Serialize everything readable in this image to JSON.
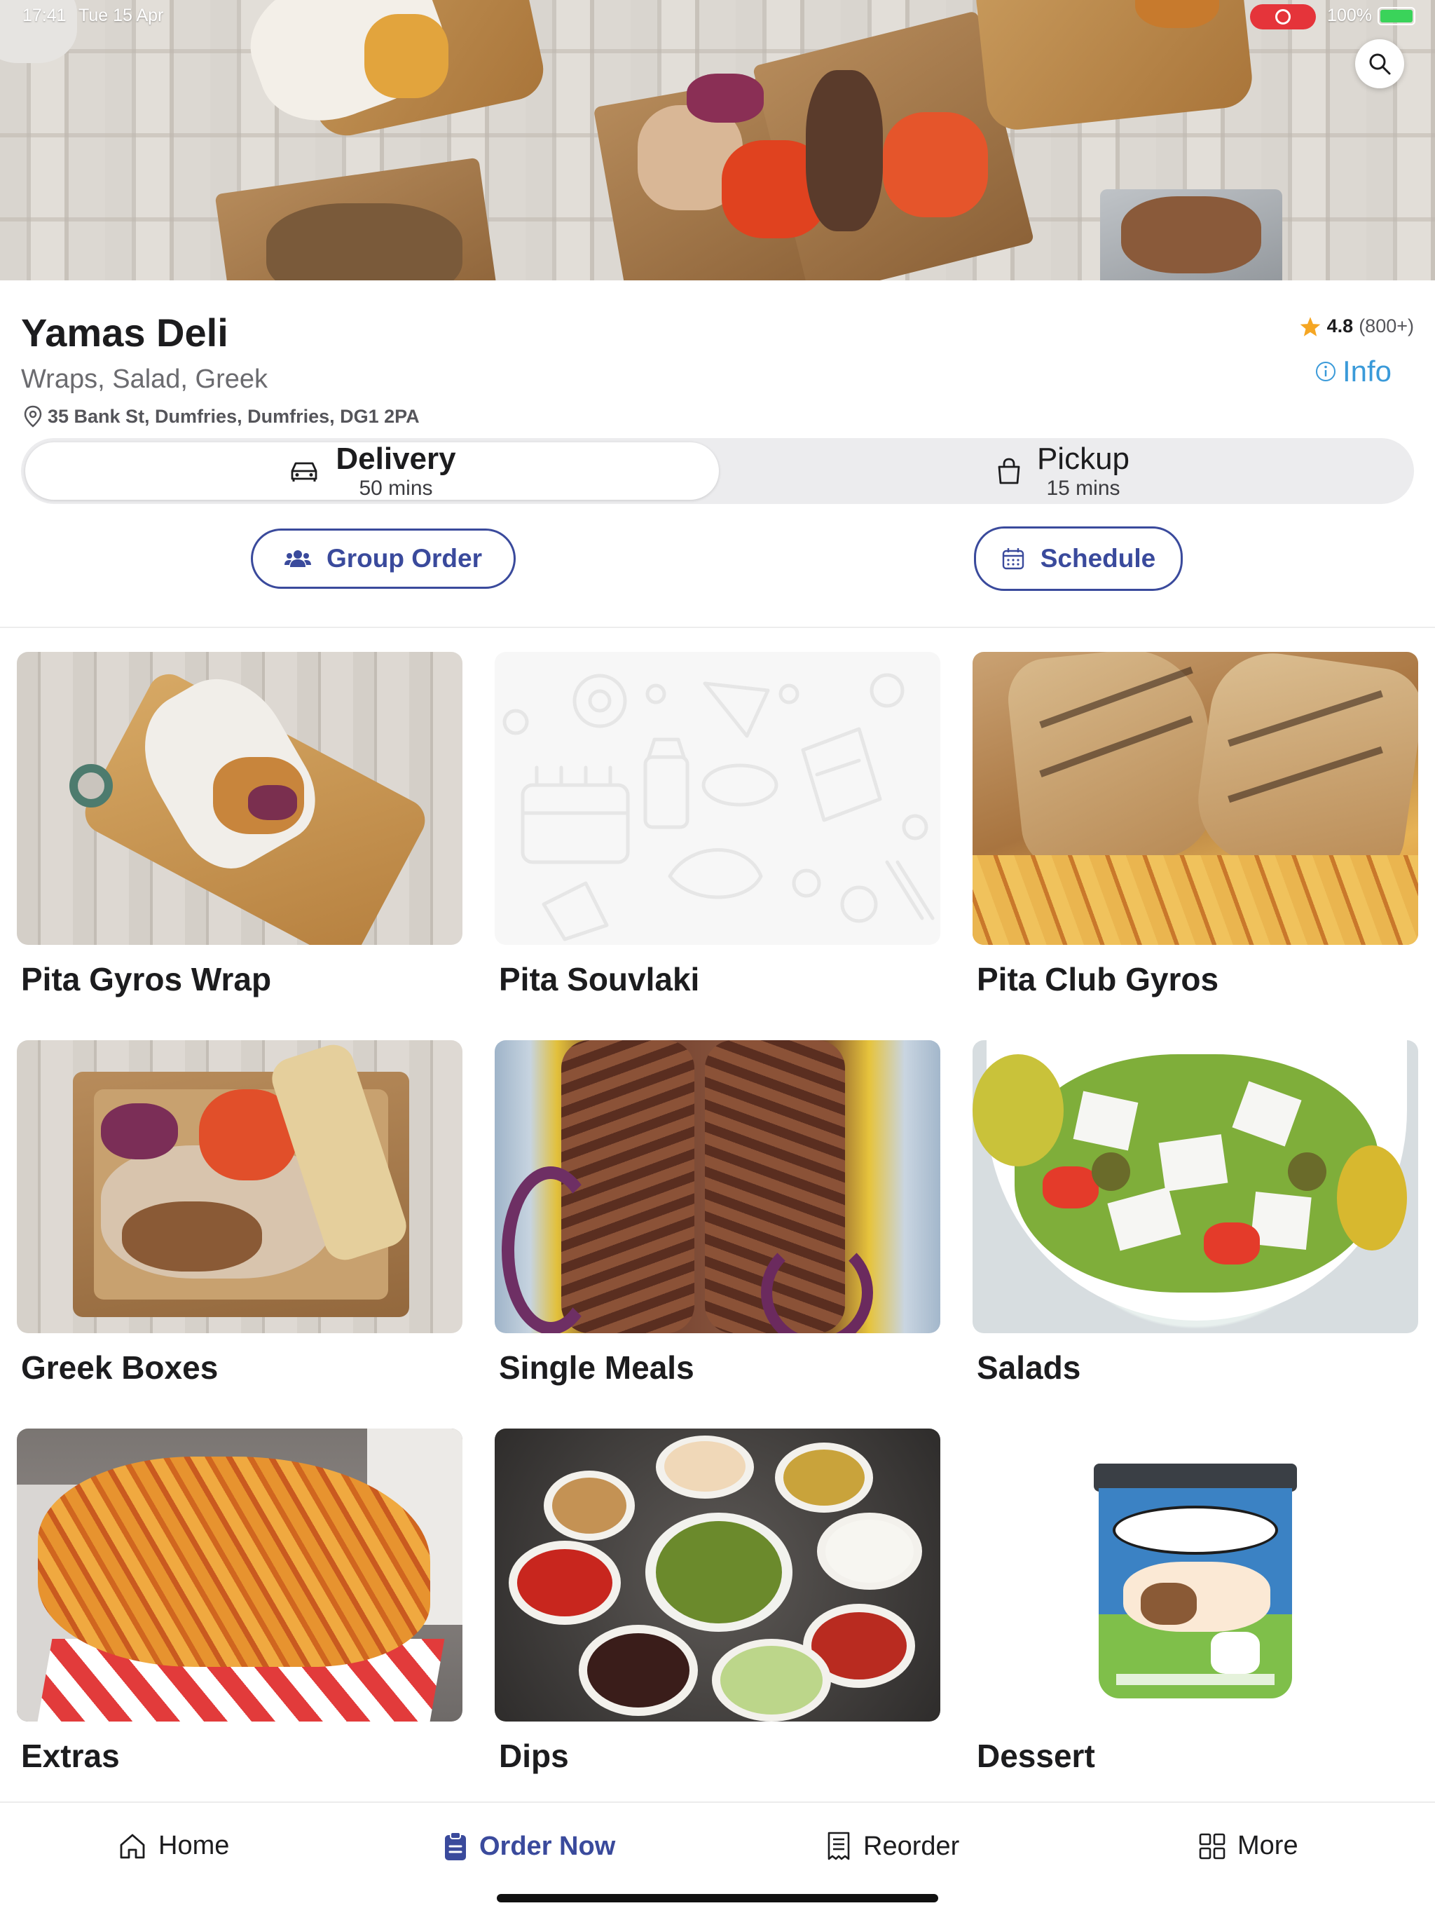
{
  "status_bar": {
    "time": "17:41",
    "date": "Tue 15 Apr",
    "battery": "100%"
  },
  "store": {
    "name": "Yamas Deli",
    "cuisine": "Wraps, Salad, Greek",
    "address": "35 Bank St, Dumfries, Dumfries, DG1 2PA",
    "rating": "4.8",
    "rating_count": "(800+)",
    "info_label": "Info"
  },
  "fulfillment": {
    "selected": "Delivery",
    "delivery": {
      "label": "Delivery",
      "time": "50 mins"
    },
    "pickup": {
      "label": "Pickup",
      "time": "15 mins"
    }
  },
  "actions": {
    "group_order": "Group Order",
    "schedule": "Schedule"
  },
  "categories": [
    {
      "label": "Pita Gyros Wrap",
      "image": "wrap-on-board"
    },
    {
      "label": "Pita Souvlaki",
      "image": "placeholder-food-doodles"
    },
    {
      "label": "Pita Club Gyros",
      "image": "grilled-pita-with-fries"
    },
    {
      "label": "Greek Boxes",
      "image": "gyros-box"
    },
    {
      "label": "Single Meals",
      "image": "grilled-kebab-tray"
    },
    {
      "label": "Salads",
      "image": "greek-salad-bowl"
    },
    {
      "label": "Extras",
      "image": "seasoned-fries"
    },
    {
      "label": "Dips",
      "image": "assorted-dips"
    },
    {
      "label": "Dessert",
      "image": "ice-cream-tub"
    }
  ],
  "bottom_nav": {
    "active": "Order Now",
    "items": [
      {
        "label": "Home",
        "icon": "house-icon"
      },
      {
        "label": "Order Now",
        "icon": "clipboard-icon"
      },
      {
        "label": "Reorder",
        "icon": "receipt-icon"
      },
      {
        "label": "More",
        "icon": "grid-icon"
      }
    ]
  },
  "colors": {
    "accent": "#3a4a9c",
    "link": "#3a9ad9",
    "star": "#f5a623",
    "record": "#e5343a"
  }
}
